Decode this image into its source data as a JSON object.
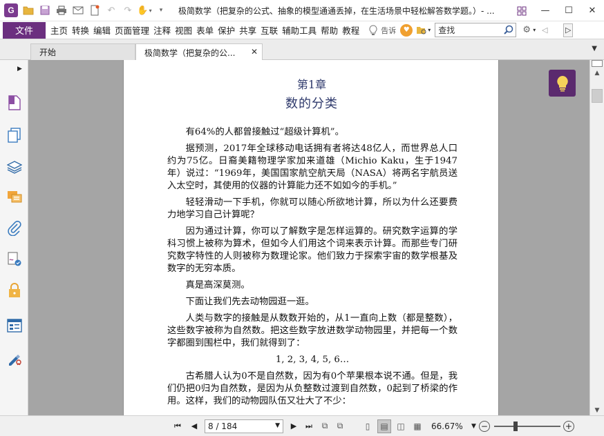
{
  "titlebar": {
    "title": "极简数学（把复杂的公式、抽象的模型通通丢掉，在生活场景中轻松解答数学题。）- ...",
    "logo_text": "G"
  },
  "menubar": {
    "file": "文件",
    "items": [
      "主页",
      "转换",
      "编辑",
      "页面管理",
      "注释",
      "视图",
      "表单",
      "保护",
      "共享",
      "互联",
      "辅助工具",
      "帮助",
      "教程"
    ],
    "tell_me": "告诉",
    "search_placeholder": "查找"
  },
  "tabs": [
    {
      "label": "开始"
    },
    {
      "label": "极简数学（把复杂的公..."
    }
  ],
  "document": {
    "chapter_num": "第1章",
    "chapter_title": "数的分类",
    "paragraphs": [
      "有64%的人都曾接触过“超级计算机”。",
      "据预测，2017年全球移动电话拥有者将达48亿人，而世界总人口约为75亿。日裔美籍物理学家加来道雄（Michio Kaku，生于1947年）说过：“1969年，美国国家航空航天局（NASA）将两名宇航员送入太空时，其使用的仪器的计算能力还不如如今的手机。”",
      "轻轻滑动一下手机，你就可以随心所欲地计算，所以为什么还要费力地学习自己计算呢？",
      "因为通过计算，你可以了解数字是怎样运算的。研究数字运算的学科习惯上被称为算术，但如今人们用这个词来表示计算。而那些专门研究数字特性的人则被称为数理论家。他们致力于探索宇宙的数学根基及数字的无穷本质。",
      "真是高深莫测。",
      "下面让我们先去动物园逛一逛。",
      "人类与数字的接触是从数数开始的，从1一直向上数（都是整数），这些数字被称为自然数。把这些数字放进数学动物园里，并把每一个数字都圈到围栏中，我们就得到了：",
      "1, 2, 3, 4, 5, 6…",
      "古希腊人认为0不是自然数，因为有0个苹果根本说不通。但是，我们仍把0归为自然数，是因为从负整数过渡到自然数，0起到了桥梁的作用。这样，我们的动物园队伍又壮大了不少："
    ]
  },
  "statusbar": {
    "page": "8 / 184",
    "zoom": "66.67%"
  },
  "colors": {
    "brand": "#6b2f7f",
    "chapter_heading": "#2f3a6c",
    "hint_button": "#5b2a6e"
  }
}
